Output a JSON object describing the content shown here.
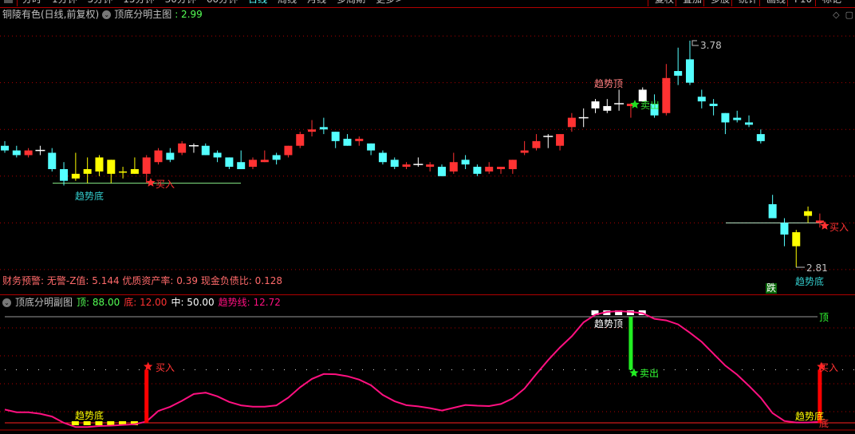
{
  "toolbar": {
    "periods": [
      "分时",
      "1分钟",
      "5分钟",
      "15分钟",
      "30分钟",
      "60分钟",
      "日线",
      "周线",
      "月线",
      "多周期",
      "更多>"
    ],
    "active_period": "日线",
    "right_buttons": [
      "复权",
      "叠加",
      "多股",
      "统计",
      "画线",
      "F10",
      "标记"
    ]
  },
  "main": {
    "stock": "铜陵有色(日线,前复权)",
    "indicator": "顶底分明主图",
    "indicator_value": ": 2.99",
    "finance": "财务预警: 无警-Z值: 5.144 优质资产率: 0.39 现金负债比: 0.128",
    "labels": {
      "bottom_left": "趋势底",
      "buy_left": "买入",
      "top": "趋势顶",
      "sell": "卖出",
      "buy_right": "买入",
      "bottom_right": "趋势底",
      "high": "3.78",
      "low": "2.81",
      "fall_badge": "跌"
    }
  },
  "sub": {
    "title": "顶底分明副图",
    "top_label": "顶: 88.00",
    "bottom_label": "底: 12.00",
    "mid_label": "中: 50.00",
    "trend_label": "趋势线: 12.72",
    "labels": {
      "bottom_left": "趋势底",
      "buy_left": "买入",
      "top": "趋势顶",
      "sell": "卖出",
      "buy_right": "买入",
      "bottom_right": "趋势底",
      "top_line": "顶",
      "bottom_line": "底"
    }
  },
  "colors": {
    "up": "#ff3232",
    "down": "#54ffff",
    "special": "#ffff00",
    "doji": "#ffffff",
    "trend": "#ff1080",
    "grid": "#b00000"
  },
  "chart_data": [
    {
      "type": "candlestick",
      "title": "顶底分明主图",
      "grid_prices": [
        3.8,
        3.6,
        3.4,
        3.2,
        3.0,
        2.8
      ],
      "high_mark": 3.78,
      "low_mark": 2.81,
      "support_left": 3.17,
      "support_right": 3.0,
      "candles": [
        [
          3.33,
          3.35,
          3.3,
          3.31,
          "down"
        ],
        [
          3.31,
          3.33,
          3.28,
          3.29,
          "down"
        ],
        [
          3.29,
          3.32,
          3.28,
          3.31,
          "up"
        ],
        [
          3.31,
          3.33,
          3.29,
          3.31,
          "doji"
        ],
        [
          3.3,
          3.32,
          3.22,
          3.23,
          "down"
        ],
        [
          3.23,
          3.26,
          3.16,
          3.18,
          "down"
        ],
        [
          3.19,
          3.3,
          3.18,
          3.21,
          "special"
        ],
        [
          3.21,
          3.28,
          3.17,
          3.23,
          "special"
        ],
        [
          3.22,
          3.29,
          3.2,
          3.28,
          "special"
        ],
        [
          3.27,
          3.27,
          3.17,
          3.21,
          "special"
        ],
        [
          3.22,
          3.24,
          3.19,
          3.22,
          "special"
        ],
        [
          3.21,
          3.28,
          3.21,
          3.23,
          "special"
        ],
        [
          3.21,
          3.29,
          3.17,
          3.28,
          "up"
        ],
        [
          3.26,
          3.32,
          3.25,
          3.31,
          "up"
        ],
        [
          3.3,
          3.32,
          3.26,
          3.27,
          "down"
        ],
        [
          3.3,
          3.35,
          3.29,
          3.34,
          "up"
        ],
        [
          3.33,
          3.34,
          3.3,
          3.33,
          "doji"
        ],
        [
          3.33,
          3.34,
          3.29,
          3.29,
          "down"
        ],
        [
          3.3,
          3.31,
          3.26,
          3.28,
          "down"
        ],
        [
          3.28,
          3.28,
          3.23,
          3.24,
          "down"
        ],
        [
          3.26,
          3.31,
          3.23,
          3.23,
          "down"
        ],
        [
          3.24,
          3.28,
          3.23,
          3.27,
          "up"
        ],
        [
          3.26,
          3.31,
          3.26,
          3.27,
          "up"
        ],
        [
          3.29,
          3.3,
          3.25,
          3.27,
          "down"
        ],
        [
          3.29,
          3.33,
          3.28,
          3.33,
          "up"
        ],
        [
          3.33,
          3.39,
          3.32,
          3.38,
          "up"
        ],
        [
          3.39,
          3.44,
          3.37,
          3.4,
          "up"
        ],
        [
          3.41,
          3.45,
          3.38,
          3.4,
          "down"
        ],
        [
          3.39,
          3.39,
          3.32,
          3.35,
          "down"
        ],
        [
          3.36,
          3.38,
          3.33,
          3.33,
          "down"
        ],
        [
          3.35,
          3.37,
          3.33,
          3.36,
          "up"
        ],
        [
          3.34,
          3.34,
          3.29,
          3.31,
          "down"
        ],
        [
          3.3,
          3.31,
          3.25,
          3.26,
          "down"
        ],
        [
          3.27,
          3.28,
          3.23,
          3.24,
          "down"
        ],
        [
          3.24,
          3.26,
          3.23,
          3.25,
          "up"
        ],
        [
          3.25,
          3.28,
          3.24,
          3.25,
          "doji"
        ],
        [
          3.24,
          3.26,
          3.22,
          3.25,
          "up"
        ],
        [
          3.24,
          3.25,
          3.2,
          3.2,
          "down"
        ],
        [
          3.22,
          3.3,
          3.21,
          3.26,
          "up"
        ],
        [
          3.27,
          3.29,
          3.23,
          3.25,
          "down"
        ],
        [
          3.24,
          3.25,
          3.2,
          3.21,
          "down"
        ],
        [
          3.22,
          3.26,
          3.21,
          3.24,
          "up"
        ],
        [
          3.23,
          3.24,
          3.21,
          3.24,
          "up"
        ],
        [
          3.23,
          3.27,
          3.21,
          3.27,
          "up"
        ],
        [
          3.3,
          3.35,
          3.29,
          3.31,
          "up"
        ],
        [
          3.32,
          3.38,
          3.31,
          3.35,
          "up"
        ],
        [
          3.37,
          3.38,
          3.32,
          3.37,
          "doji"
        ],
        [
          3.33,
          3.38,
          3.31,
          3.38,
          "up"
        ],
        [
          3.41,
          3.47,
          3.39,
          3.45,
          "up"
        ],
        [
          3.45,
          3.49,
          3.41,
          3.45,
          "doji"
        ],
        [
          3.49,
          3.53,
          3.47,
          3.52,
          "doji"
        ],
        [
          3.5,
          3.53,
          3.47,
          3.48,
          "doji"
        ],
        [
          3.51,
          3.57,
          3.48,
          3.5,
          "doji"
        ],
        [
          3.5,
          3.51,
          3.45,
          3.51,
          "up"
        ],
        [
          3.52,
          3.58,
          3.52,
          3.57,
          "doji"
        ],
        [
          3.51,
          3.55,
          3.45,
          3.46,
          "down"
        ],
        [
          3.47,
          3.68,
          3.46,
          3.62,
          "up"
        ],
        [
          3.65,
          3.75,
          3.59,
          3.63,
          "down"
        ],
        [
          3.7,
          3.78,
          3.59,
          3.6,
          "down"
        ],
        [
          3.54,
          3.57,
          3.49,
          3.52,
          "down"
        ],
        [
          3.51,
          3.53,
          3.46,
          3.5,
          "down"
        ],
        [
          3.47,
          3.47,
          3.38,
          3.43,
          "down"
        ],
        [
          3.45,
          3.48,
          3.43,
          3.44,
          "down"
        ],
        [
          3.43,
          3.46,
          3.41,
          3.42,
          "down"
        ],
        [
          3.38,
          3.4,
          3.34,
          3.35,
          "down"
        ],
        [
          3.08,
          3.12,
          3.02,
          3.02,
          "down"
        ],
        [
          3.0,
          3.02,
          2.9,
          2.95,
          "down"
        ],
        [
          2.96,
          2.97,
          2.81,
          2.9,
          "special"
        ],
        [
          3.05,
          3.07,
          3.0,
          3.03,
          "special"
        ],
        [
          3.0,
          3.04,
          2.98,
          3.01,
          "up"
        ]
      ]
    },
    {
      "type": "line",
      "title": "顶底分明副图",
      "ylim": [
        12,
        88
      ],
      "grid_values": [
        80,
        60,
        40,
        20
      ],
      "top": 88,
      "mid": 50,
      "bottom": 12,
      "trend": [
        21.5,
        19.6,
        19.6,
        18.5,
        16.5,
        12,
        9,
        9,
        9.7,
        10,
        10.5,
        11,
        13,
        20.5,
        23.5,
        27.8,
        32.6,
        33.6,
        31,
        27,
        24.5,
        23.6,
        23.6,
        24.5,
        30,
        37.5,
        43.5,
        47,
        46.8,
        45.4,
        43,
        39,
        32,
        27.5,
        24.6,
        23.8,
        22.5,
        20.8,
        22.8,
        24.8,
        24.3,
        24,
        25.5,
        29.5,
        36.5,
        47,
        57,
        66,
        74,
        84,
        89.5,
        91.5,
        92,
        91.5,
        90.5,
        86.5,
        85.4,
        82.5,
        76.5,
        70,
        61.5,
        53,
        46.5,
        38.5,
        30,
        19,
        13.3,
        12.2,
        12.2,
        12.72
      ],
      "bottom_zone_indices": [
        6,
        11
      ],
      "top_zone_indices": [
        50,
        54
      ],
      "buy_bars": [
        12,
        69
      ],
      "sell_bars": [
        53
      ]
    }
  ]
}
